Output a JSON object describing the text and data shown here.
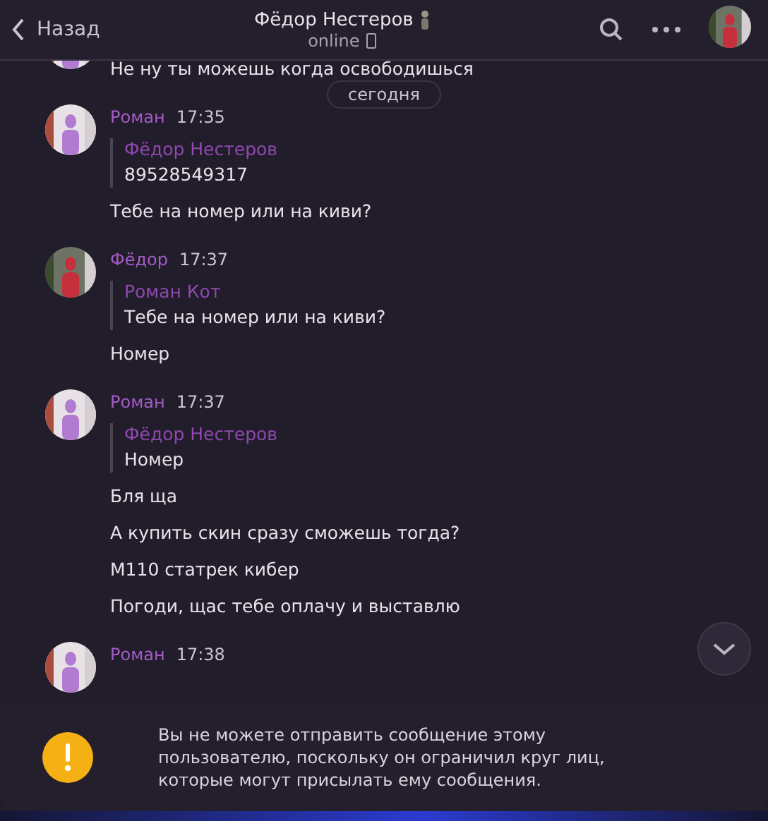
{
  "header": {
    "back_label": "Назад",
    "title": "Фёдор Нестеров",
    "status": "online"
  },
  "date_pill": "сегодня",
  "messages": [
    {
      "kind": "continuation",
      "texts": [
        "Не ну ты можешь когда освободишься"
      ]
    },
    {
      "kind": "group",
      "author": "Роман",
      "time": "17:35",
      "reply": {
        "author": "Фёдор Нестеров",
        "text": "89528549317"
      },
      "texts": [
        "Тебе на номер или на киви?"
      ]
    },
    {
      "kind": "group",
      "author": "Фёдор",
      "time": "17:37",
      "reply": {
        "author": "Роман Кот",
        "text": "Тебе на номер или на киви?"
      },
      "texts": [
        "Номер"
      ]
    },
    {
      "kind": "group",
      "author": "Роман",
      "time": "17:37",
      "reply": {
        "author": "Фёдор Нестеров",
        "text": "Номер"
      },
      "texts": [
        "Бля ща",
        "А купить скин сразу сможешь тогда?",
        "М110 статрек кибер",
        "Погоди, щас тебе оплачу и выставлю"
      ]
    },
    {
      "kind": "group",
      "author": "Роман",
      "time": "17:38"
    }
  ],
  "notice": "Вы не можете отправить сообщение этому пользователю, поскольку он ограничил круг лиц, которые могут присылать ему сообщения."
}
